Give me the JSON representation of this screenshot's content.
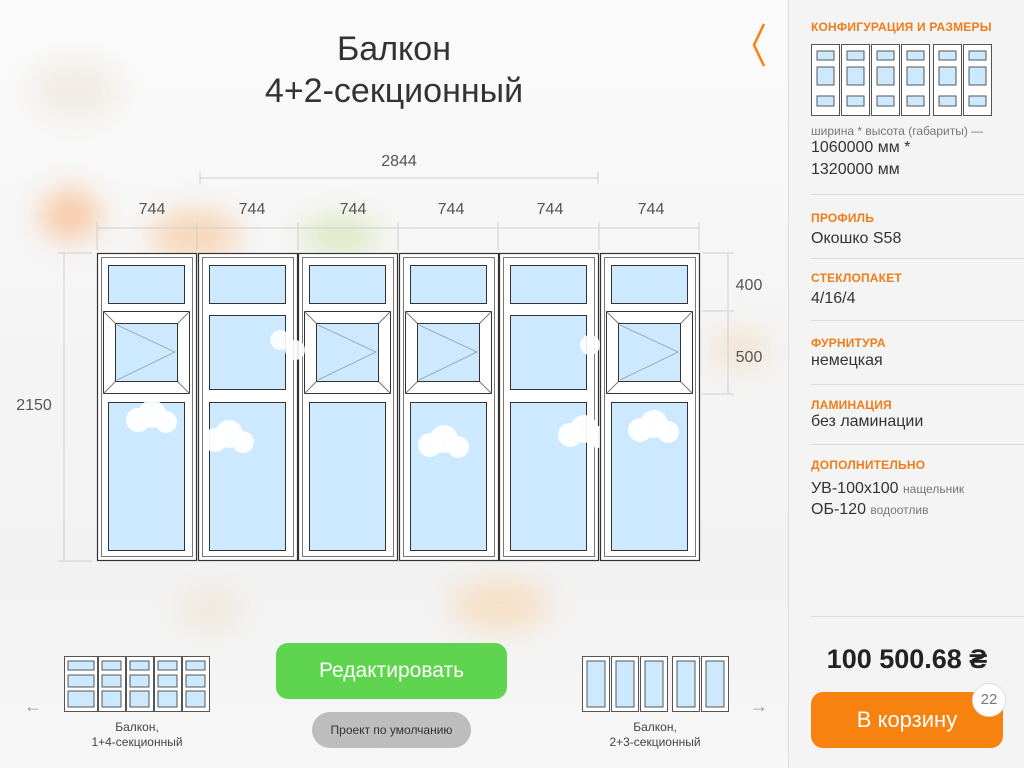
{
  "title": {
    "line1": "Балкон",
    "line2": "4+2-секционный"
  },
  "drawing": {
    "total_width_label": "2844",
    "section_width_labels": [
      "744",
      "744",
      "744",
      "744",
      "744",
      "744"
    ],
    "height_label": "2150",
    "top_row_label": "400",
    "middle_row_label": "500"
  },
  "sidebar": {
    "config": {
      "heading": "КОНФИГУРАЦИЯ И РАЗМЕРЫ",
      "note": "ширина * высота (габариты) —",
      "size_line1": "1060000 мм *",
      "size_line2": "1320000 мм"
    },
    "profile": {
      "heading": "ПРОФИЛЬ",
      "value": "Окошко S58"
    },
    "glass": {
      "heading": "СТЕКЛОПАКЕТ",
      "value": "4/16/4"
    },
    "hardware": {
      "heading": "ФУРНИТУРА",
      "value": "немецкая"
    },
    "lamination": {
      "heading": "ЛАМИНАЦИЯ",
      "value": "без ламинации"
    },
    "extra": {
      "heading": "ДОПОЛНИТЕЛЬНО",
      "item1": "УВ-100х100",
      "item1_note": "нащельник",
      "item2": "ОБ-120",
      "item2_note": "водоотлив"
    },
    "price": "100 500.68 ₴",
    "cart_label": "В корзину",
    "cart_count": "22"
  },
  "actions": {
    "edit_label": "Редактировать",
    "default_label": "Проект по умолчанию"
  },
  "prev_variant": {
    "line1": "Балкон,",
    "line2": "1+4-секционный"
  },
  "next_variant": {
    "line1": "Балкон,",
    "line2": "2+3-секционный"
  },
  "colors": {
    "accent": "#f7820f",
    "accent_text": "#f07d1a",
    "edit": "#5fd44e",
    "glass": "#cde9ff"
  },
  "icons": {
    "back": "chevron-left-icon",
    "prev": "arrow-left-icon",
    "next": "arrow-right-icon"
  }
}
